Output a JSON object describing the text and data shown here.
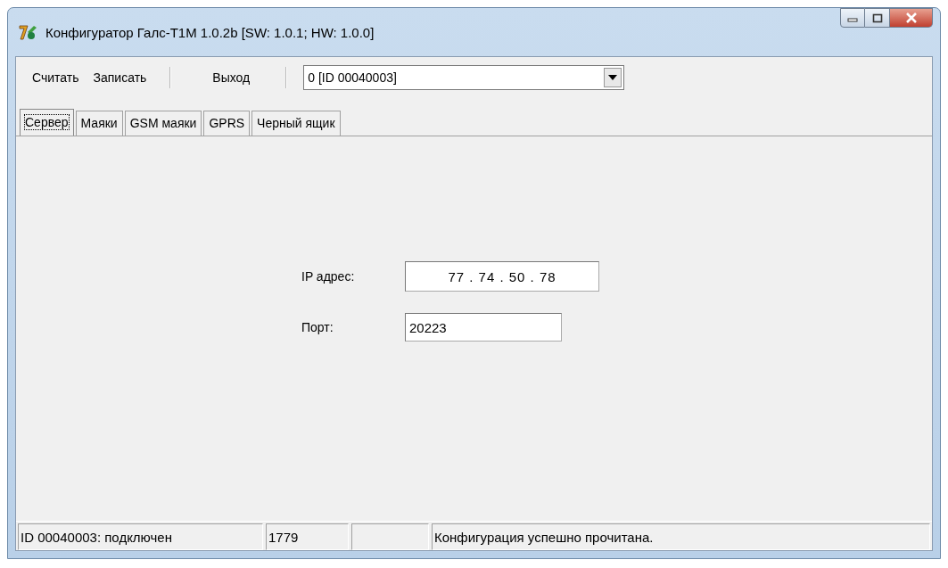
{
  "window": {
    "title": "Конфигуратор Галс-T1M 1.0.2b [SW: 1.0.1; HW: 1.0.0]"
  },
  "toolbar": {
    "buttons": [
      "Считать",
      "Записать"
    ],
    "exit": "Выход",
    "device": "0 [ID 00040003]"
  },
  "tabs": [
    {
      "label": "Сервер",
      "selected": true
    },
    {
      "label": "Маяки",
      "selected": false
    },
    {
      "label": "GSM маяки",
      "selected": false
    },
    {
      "label": "GPRS",
      "selected": false
    },
    {
      "label": "Черный ящик",
      "selected": false
    }
  ],
  "form": {
    "ip_label": "IP адрес:",
    "ip_value": "77 . 74 . 50 . 78",
    "port_label": "Порт:",
    "port_value": "20223"
  },
  "status_bar": [
    {
      "text": "ID 00040003: подключен"
    },
    {
      "text": "1779"
    },
    {
      "text": "Конфигурация успешно прочитана."
    }
  ]
}
